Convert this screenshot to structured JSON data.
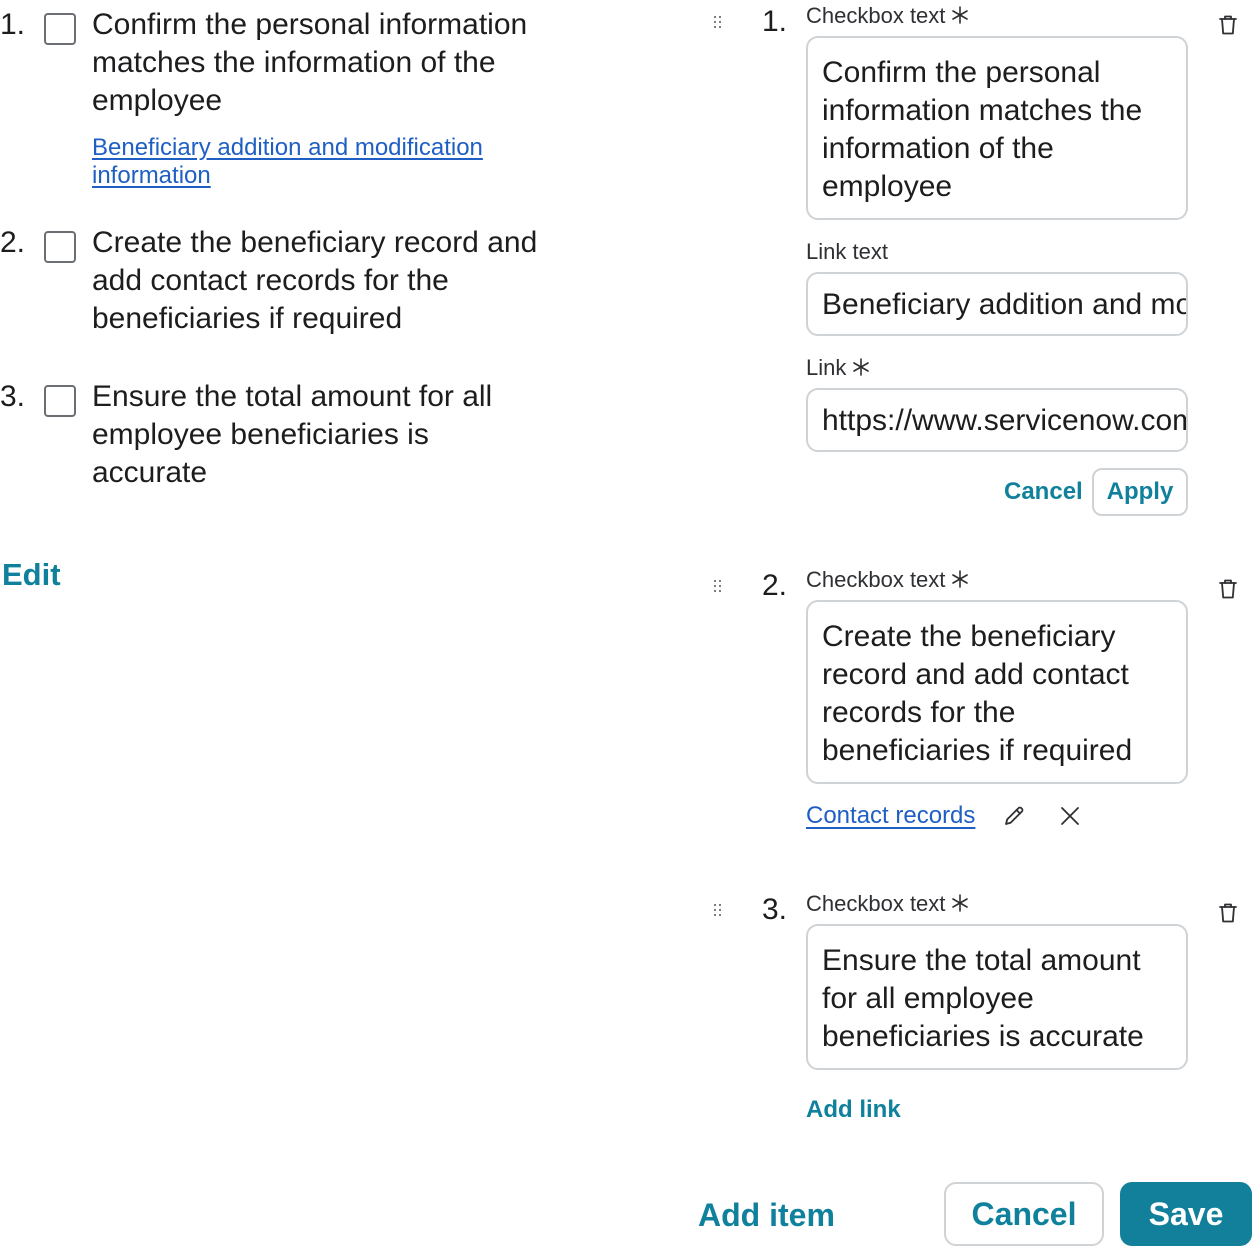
{
  "preview": {
    "items": [
      {
        "number": "1.",
        "text": "Confirm the personal information matches the information of the employee",
        "link": "Beneficiary addition and modification information"
      },
      {
        "number": "2.",
        "text": "Create the beneficiary record and add contact records for the beneficiaries if required"
      },
      {
        "number": "3.",
        "text": "Ensure the total amount for all employee beneficiaries is accurate"
      }
    ],
    "edit_label": "Edit"
  },
  "editor": {
    "items": [
      {
        "number": "1.",
        "checkbox_label": "Checkbox text",
        "checkbox_text": "Confirm the personal information matches the information of the employee",
        "link_text_label": "Link text",
        "link_text_value": "Beneficiary addition and modification information",
        "link_label": "Link",
        "link_value": "https://www.servicenow.com",
        "cancel_label": "Cancel",
        "apply_label": "Apply"
      },
      {
        "number": "2.",
        "checkbox_label": "Checkbox text",
        "checkbox_text": "Create the beneficiary record and add contact records for the beneficiaries if required",
        "link": "Contact records"
      },
      {
        "number": "3.",
        "checkbox_label": "Checkbox text",
        "checkbox_text": "Ensure the total amount for all employee beneficiaries is accurate",
        "add_link_label": "Add link"
      }
    ]
  },
  "footer": {
    "add_item_label": "Add item",
    "cancel_label": "Cancel",
    "save_label": "Save"
  },
  "colors": {
    "accent": "#10819c",
    "link": "#1f5fc4",
    "save_bg": "#12809a",
    "border": "#d0d3d6"
  },
  "icons": [
    "drag-handle-icon",
    "required-asterisk-icon",
    "trash-icon",
    "pencil-icon",
    "close-icon"
  ]
}
